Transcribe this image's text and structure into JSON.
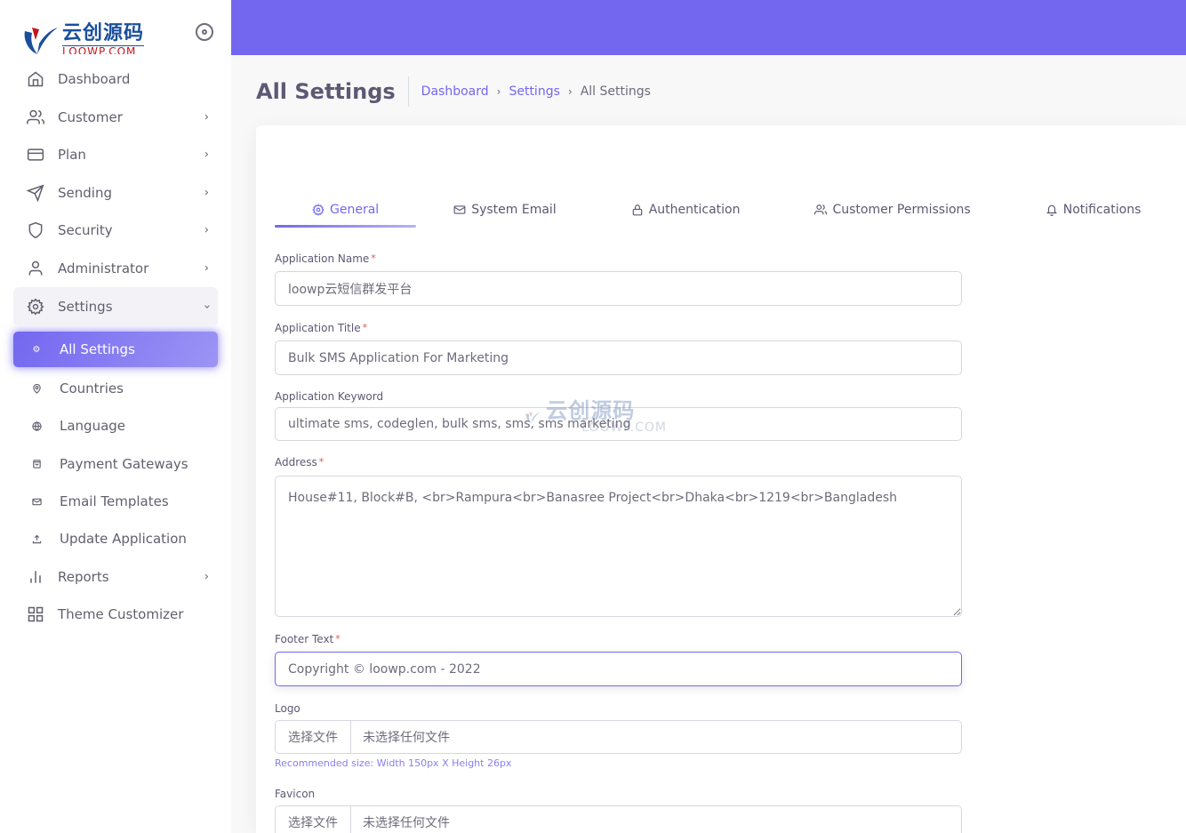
{
  "brand": {
    "name_cn": "云创源码",
    "name_en": "LOOWP.COM"
  },
  "colors": {
    "primary": "#7367f0",
    "danger": "#ea5455",
    "text": "#6e6b7b"
  },
  "sidebar": {
    "items": [
      {
        "label": "Dashboard",
        "icon": "home-icon",
        "has_children": false
      },
      {
        "label": "Customer",
        "icon": "users-icon",
        "has_children": true
      },
      {
        "label": "Plan",
        "icon": "credit-card-icon",
        "has_children": true
      },
      {
        "label": "Sending",
        "icon": "send-icon",
        "has_children": true
      },
      {
        "label": "Security",
        "icon": "shield-icon",
        "has_children": true
      },
      {
        "label": "Administrator",
        "icon": "user-icon",
        "has_children": true
      },
      {
        "label": "Settings",
        "icon": "settings-icon",
        "has_children": true,
        "expanded": true
      }
    ],
    "settings_children": [
      {
        "label": "All Settings",
        "icon": "settings-icon",
        "active": true
      },
      {
        "label": "Countries",
        "icon": "map-pin-icon"
      },
      {
        "label": "Language",
        "icon": "globe-icon"
      },
      {
        "label": "Payment Gateways",
        "icon": "shopping-bag-icon"
      },
      {
        "label": "Email Templates",
        "icon": "mail-icon"
      },
      {
        "label": "Update Application",
        "icon": "upload-icon"
      }
    ],
    "bottom_items": [
      {
        "label": "Reports",
        "icon": "bar-chart-icon",
        "has_children": true
      },
      {
        "label": "Theme Customizer",
        "icon": "grid-icon",
        "has_children": false
      }
    ]
  },
  "page": {
    "title": "All Settings",
    "breadcrumb": [
      {
        "label": "Dashboard",
        "link": true
      },
      {
        "label": "Settings",
        "link": true
      },
      {
        "label": "All Settings",
        "link": false
      }
    ]
  },
  "tabs": [
    {
      "label": "General",
      "icon": "settings-icon",
      "active": true
    },
    {
      "label": "System Email",
      "icon": "mail-icon"
    },
    {
      "label": "Authentication",
      "icon": "lock-icon"
    },
    {
      "label": "Customer Permissions",
      "icon": "users-icon"
    },
    {
      "label": "Notifications",
      "icon": "bell-icon"
    }
  ],
  "form": {
    "app_name": {
      "label": "Application Name",
      "required": "*",
      "value": "loowp云短信群发平台"
    },
    "app_title": {
      "label": "Application Title",
      "required": "*",
      "value": "Bulk SMS Application For Marketing"
    },
    "app_keyword": {
      "label": "Application Keyword",
      "value": "ultimate sms, codeglen, bulk sms, sms, sms marketing"
    },
    "address": {
      "label": "Address",
      "required": "*",
      "value": "House#11, Block#B, <br>Rampura<br>Banasree Project<br>Dhaka<br>1219<br>Bangladesh"
    },
    "footer_text": {
      "label": "Footer Text",
      "required": "*",
      "value": "Copyright © loowp.com - 2022"
    },
    "logo": {
      "label": "Logo",
      "button": "选择文件",
      "file_status": "未选择任何文件",
      "hint": "Recommended size: Width 150px X Height 26px"
    },
    "favicon": {
      "label": "Favicon",
      "button": "选择文件",
      "file_status": "未选择任何文件"
    }
  },
  "watermark": {
    "cn": "云创源码",
    "en": "LOOWP.COM"
  }
}
